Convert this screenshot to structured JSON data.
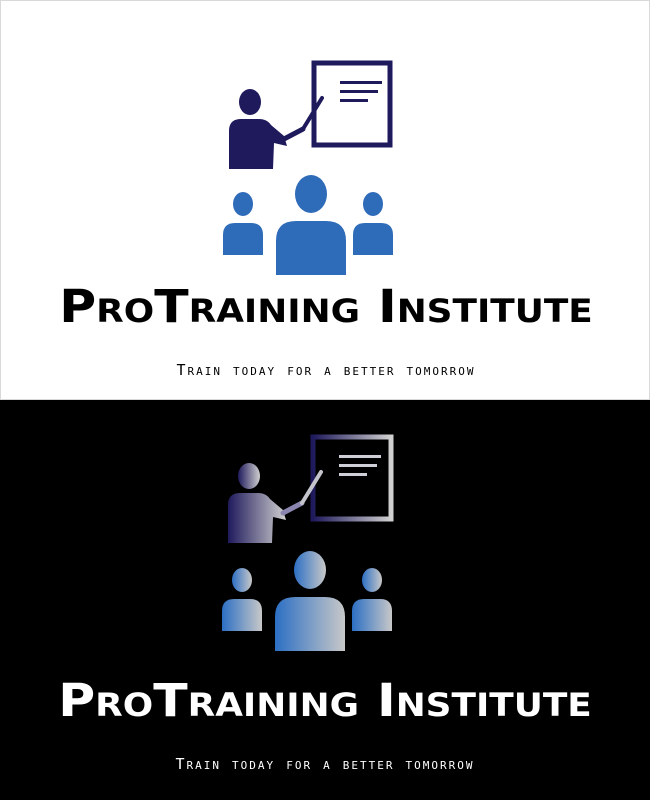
{
  "logo": {
    "brand_name_part1": "ProTraining",
    "brand_name_part2": "Institute",
    "tagline": "Train today for a better tomorrow"
  },
  "colors": {
    "navy": "#1f1a5c",
    "blue": "#2e6bb8",
    "light_background": "#ffffff",
    "dark_background": "#000000",
    "gradient_blue": "#4a90d9",
    "gradient_grey": "#c8c8c8"
  },
  "icons": [
    "presenter-icon",
    "whiteboard-icon",
    "audience-icon"
  ]
}
